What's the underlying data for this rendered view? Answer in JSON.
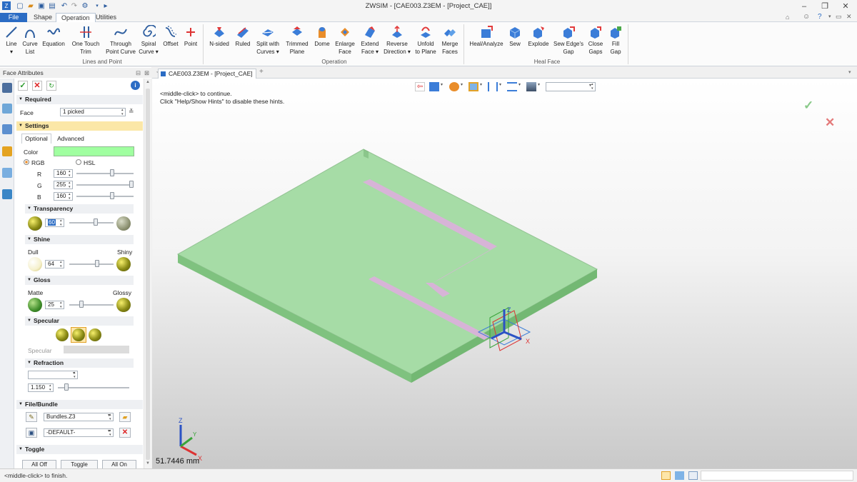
{
  "app": {
    "title": "ZWSIM - [CAE003.Z3EM - [Project_CAE]]"
  },
  "menu": {
    "tabs": [
      "File",
      "Shape",
      "Operation",
      "Utilities"
    ],
    "active": "Operation"
  },
  "ribbon": {
    "groups": [
      {
        "name": "Lines and Point",
        "buttons": [
          {
            "line1": "Line",
            "line2": "▾",
            "icon": "line-icon"
          },
          {
            "line1": "Curve",
            "line2": "List",
            "icon": "curve-list-icon"
          },
          {
            "line1": "Equation",
            "line2": "",
            "icon": "equation-icon"
          },
          {
            "line1": "One Touch",
            "line2": "Trim",
            "icon": "one-touch-trim-icon"
          },
          {
            "line1": "Through",
            "line2": "Point Curve",
            "icon": "through-point-curve-icon"
          },
          {
            "line1": "Spiral",
            "line2": "Curve ▾",
            "icon": "spiral-curve-icon"
          },
          {
            "line1": "Offset",
            "line2": "",
            "icon": "offset-icon"
          },
          {
            "line1": "Point",
            "line2": "",
            "icon": "point-icon"
          }
        ]
      },
      {
        "name": "Operation",
        "buttons": [
          {
            "line1": "N-sided",
            "line2": "",
            "icon": "n-sided-icon"
          },
          {
            "line1": "Ruled",
            "line2": "",
            "icon": "ruled-icon"
          },
          {
            "line1": "Split with",
            "line2": "Curves ▾",
            "icon": "split-with-curves-icon"
          },
          {
            "line1": "Trimmed",
            "line2": "Plane",
            "icon": "trimmed-plane-icon"
          },
          {
            "line1": "Dome",
            "line2": "",
            "icon": "dome-icon"
          },
          {
            "line1": "Enlarge",
            "line2": "Face",
            "icon": "enlarge-face-icon"
          },
          {
            "line1": "Extend",
            "line2": "Face ▾",
            "icon": "extend-face-icon"
          },
          {
            "line1": "Reverse",
            "line2": "Direction ▾",
            "icon": "reverse-direction-icon"
          },
          {
            "line1": "Unfold",
            "line2": "to Plane",
            "icon": "unfold-to-plane-icon"
          },
          {
            "line1": "Merge",
            "line2": "Faces",
            "icon": "merge-faces-icon"
          }
        ]
      },
      {
        "name": "Heal Face",
        "buttons": [
          {
            "line1": "Heal/Analyze",
            "line2": "",
            "icon": "heal-analyze-icon"
          },
          {
            "line1": "Sew",
            "line2": "",
            "icon": "sew-icon"
          },
          {
            "line1": "Explode",
            "line2": "",
            "icon": "explode-icon"
          },
          {
            "line1": "Sew Edge's",
            "line2": "Gap",
            "icon": "sew-edges-gap-icon"
          },
          {
            "line1": "Close",
            "line2": "Gaps",
            "icon": "close-gaps-icon"
          },
          {
            "line1": "Fill",
            "line2": "Gap",
            "icon": "fill-gap-icon"
          }
        ]
      }
    ]
  },
  "panel": {
    "title": "Face Attributes",
    "required": {
      "header": "Required",
      "face_label": "Face",
      "face_value": "1 picked"
    },
    "settings": {
      "header": "Settings",
      "tabs": [
        "Optional",
        "Advanced"
      ],
      "active_tab": "Optional"
    },
    "color": {
      "label": "Color",
      "swatch": "#a0ffa0",
      "mode_rgb": "RGB",
      "mode_hsl": "HSL",
      "selected_mode": "RGB",
      "channels": [
        {
          "label": "R",
          "value": "160",
          "fraction": 0.63
        },
        {
          "label": "G",
          "value": "255",
          "fraction": 1.0
        },
        {
          "label": "B",
          "value": "160",
          "fraction": 0.63
        }
      ]
    },
    "transparency": {
      "header": "Transparency",
      "value": "60",
      "fraction": 0.6
    },
    "shine": {
      "header": "Shine",
      "min_label": "Dull",
      "max_label": "Shiny",
      "value": "64",
      "fraction": 0.64
    },
    "gloss": {
      "header": "Gloss",
      "min_label": "Matte",
      "max_label": "Glossy",
      "value": "25",
      "fraction": 0.25
    },
    "specular": {
      "header": "Specular",
      "label": "Specular",
      "selected": 1
    },
    "refraction": {
      "header": "Refraction",
      "dropdown": "",
      "value": "1.150",
      "fraction": 0.1
    },
    "file_bundle": {
      "header": "File/Bundle",
      "bundle": "Bundles.Z3",
      "default": "-DEFAULT-"
    },
    "toggle": {
      "header": "Toggle",
      "buttons": [
        "All Off",
        "Toggle",
        "All On"
      ]
    }
  },
  "doc": {
    "tab": "CAE003.Z3EM - [Project_CAE]",
    "add": "+"
  },
  "viewport": {
    "hint1": "<middle-click> to continue.",
    "hint2": "Click \"Help/Show Hints\" to disable these hints.",
    "scale": "51.7446 mm",
    "view_combo": "",
    "colors": {
      "plate_top": "#a6dca6",
      "trace": "#d7b4d7",
      "accept": "#89c989",
      "cancel": "#e47a7a"
    }
  },
  "status": {
    "text": "<middle-click> to finish."
  }
}
